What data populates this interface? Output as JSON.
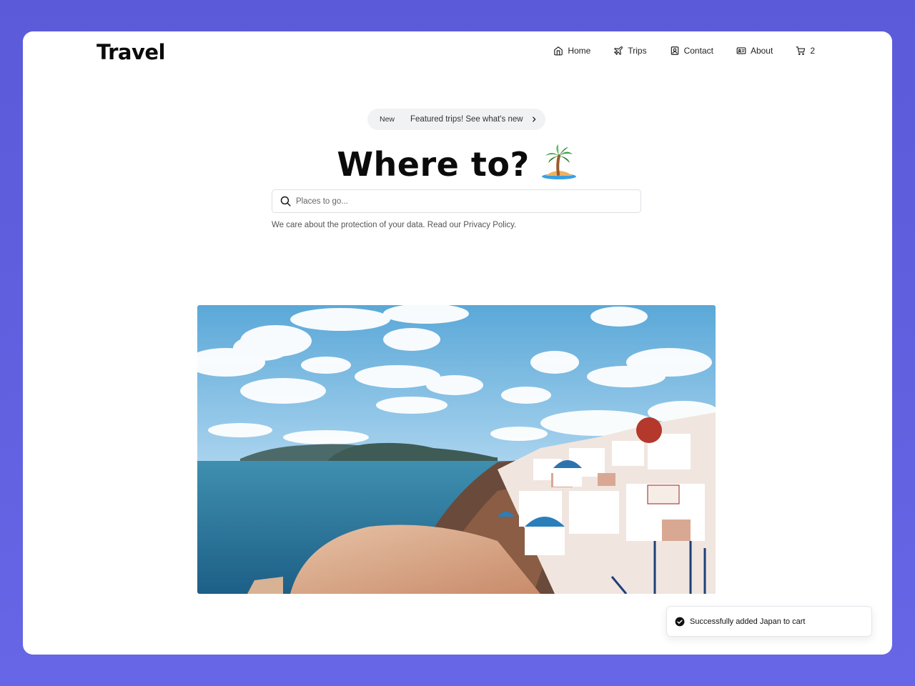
{
  "header": {
    "logo": "Travel",
    "nav": [
      {
        "label": "Home",
        "icon": "home-icon"
      },
      {
        "label": "Trips",
        "icon": "plane-icon"
      },
      {
        "label": "Contact",
        "icon": "contact-card-icon"
      },
      {
        "label": "About",
        "icon": "id-card-icon"
      }
    ],
    "cart_count": "2"
  },
  "hero": {
    "pill_badge": "New",
    "pill_text": "Featured trips! See what's new",
    "headline": "Where to?",
    "headline_icon": "palm-tree-island-icon",
    "search_placeholder": "Places to go...",
    "privacy_prefix": "We care about the protection of your data. Read our ",
    "privacy_link": "Privacy Policy",
    "privacy_suffix": ".",
    "image_alt": "santorini-photo"
  },
  "toast": {
    "message": "Successfully added Japan to cart",
    "icon": "check-circle-icon"
  },
  "colors": {
    "background": "#5b5bd9",
    "card": "#ffffff",
    "pill": "#f1f2f4"
  }
}
